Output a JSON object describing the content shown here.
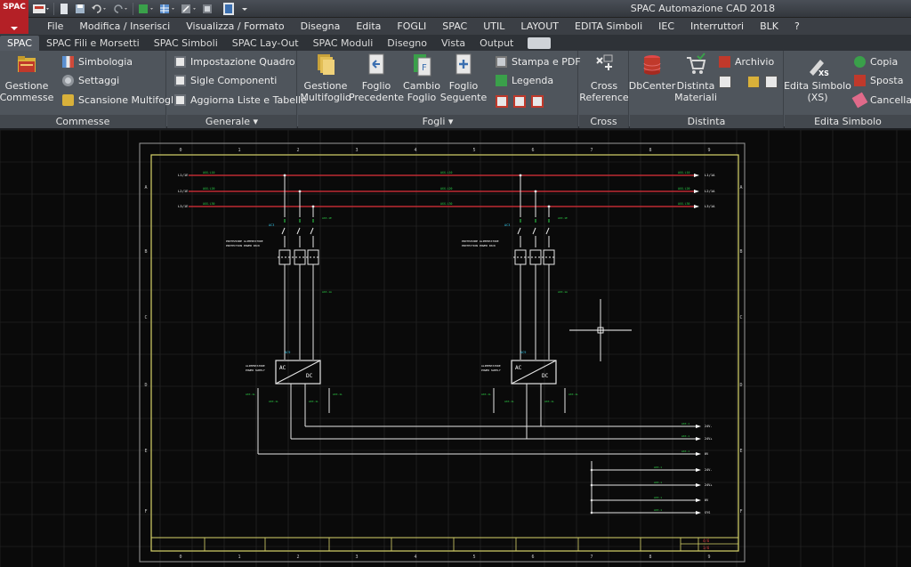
{
  "app": {
    "title": "SPAC Automazione CAD 2018",
    "logo_text": "SPAC"
  },
  "quick_access": {
    "icons": [
      "app-menu-icon",
      "new-icon",
      "save-icon",
      "undo-icon",
      "redo-icon",
      "layers-icon",
      "grid-icon",
      "settings-icon",
      "window-icon"
    ]
  },
  "menu": [
    "File",
    "Modifica / Inserisci",
    "Visualizza / Formato",
    "Disegna",
    "Edita",
    "FOGLI",
    "SPAC",
    "UTIL",
    "LAYOUT",
    "EDITA Simboli",
    "IEC",
    "Interruttori",
    "BLK",
    "?"
  ],
  "tabs": [
    "SPAC",
    "SPAC Fili e Morsetti",
    "SPAC Simboli",
    "SPAC Lay-Out",
    "SPAC Moduli",
    "Disegno",
    "Vista",
    "Output"
  ],
  "ribbon": {
    "commesse": {
      "label": "Commesse",
      "gestione": "Gestione\nCommesse",
      "simbologia": "Simbologia",
      "settaggi": "Settaggi",
      "scansione": "Scansione Multifogli"
    },
    "generale": {
      "label": "Generale ▾",
      "impostazione": "Impostazione Quadro",
      "sigle": "Sigle Componenti",
      "aggiorna": "Aggiorna Liste e Tabelle"
    },
    "fogli": {
      "label": "Fogli ▾",
      "gestione_multi": "Gestione\nMultifoglio",
      "precedente": "Foglio\nPrecedente",
      "cambio": "Cambio\nFoglio",
      "seguente": "Foglio\nSeguente",
      "stampa": "Stampa e PDF",
      "legenda": "Legenda"
    },
    "cross": {
      "label": "Cross",
      "cross_ref": "Cross\nReference"
    },
    "distinta": {
      "label": "Distinta",
      "dbcenter": "DbCenter",
      "distinta_mat": "Distinta\nMateriali",
      "archivio": "Archivio"
    },
    "edita": {
      "label": "Edita Simbolo",
      "edita_xs": "Edita Simbolo\n(XS)",
      "copia": "Copia",
      "sposta": "Sposta",
      "cancella": "Cancella"
    }
  },
  "drawing": {
    "col_numbers": [
      "0",
      "1",
      "2",
      "3",
      "4",
      "5",
      "6",
      "7",
      "8",
      "9"
    ],
    "row_letters": [
      "A",
      "B",
      "C",
      "D",
      "E",
      "F"
    ],
    "colors": {
      "frame": "#d8d46a",
      "phase_line": "#e0303a",
      "wire": "#e6e6e6",
      "label": "#2fd84a",
      "tag": "#34c6e8",
      "grid": "#2a2a2a"
    },
    "phase_labels": [
      "L1/1E",
      "L2/1E",
      "L3/1E"
    ],
    "phase_targets": [
      "L1/1A",
      "L2/1A",
      "L3/1A"
    ],
    "wire_tags": [
      "AXX.L10",
      "AXX.L20",
      "AXX.L30"
    ],
    "breaker": {
      "tag": "AC3",
      "desc1": "PROTEZIONE ALIMENTATORE",
      "desc2": "PROTECTION POWER PACK"
    },
    "psu": {
      "tag": "AC9",
      "ac": "AC",
      "dc": "DC",
      "desc1": "ALIMENTATORE",
      "desc2": "POWER SUPPLY"
    },
    "outputs": [
      "24V-",
      "24V+",
      "0V",
      "24V-",
      "24V+",
      "0V",
      "SYS"
    ],
    "title_block": {
      "sheet": "4/6",
      "rev": "1/6"
    }
  }
}
